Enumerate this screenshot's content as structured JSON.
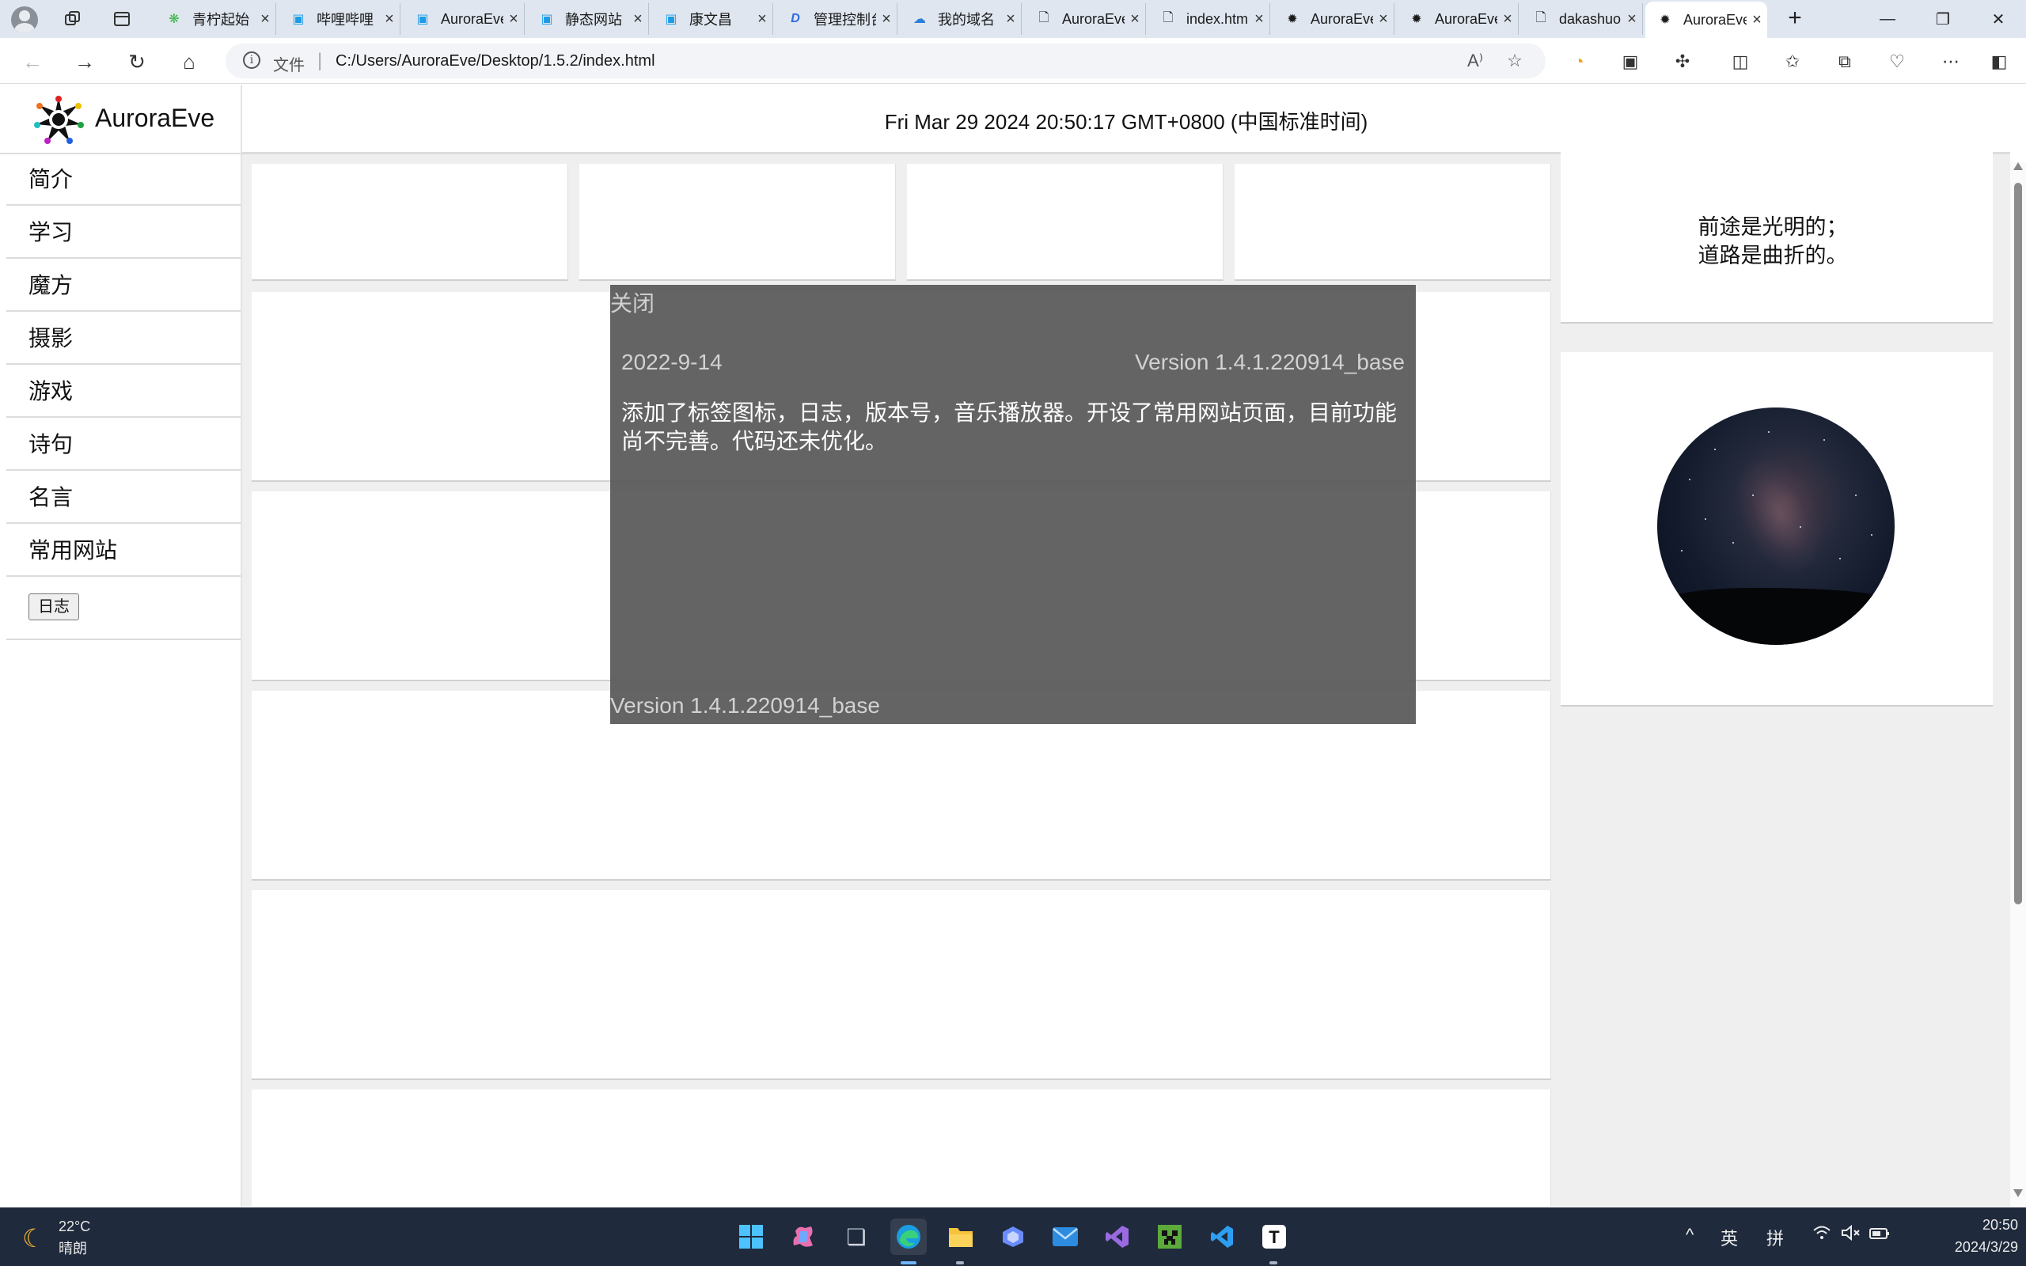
{
  "browser": {
    "tabs": [
      {
        "title": "青柠起始",
        "icon": "lime-icon",
        "color": "#3bb54a"
      },
      {
        "title": "哔哩哔哩",
        "icon": "bilibili-icon",
        "color": "#1e9be6"
      },
      {
        "title": "AuroraEve",
        "icon": "bilibili-icon",
        "color": "#1e9be6"
      },
      {
        "title": "静态网站",
        "icon": "bilibili-icon",
        "color": "#1e9be6"
      },
      {
        "title": "康文昌",
        "icon": "bilibili-icon",
        "color": "#1e9be6"
      },
      {
        "title": "管理控制台",
        "icon": "d-logo-icon",
        "color": "#2e6be6"
      },
      {
        "title": "我的域名",
        "icon": "cloud-icon",
        "color": "#2b7fd8"
      },
      {
        "title": "AuroraEve",
        "icon": "file-icon",
        "color": "#444444"
      },
      {
        "title": "index.html",
        "icon": "file-icon",
        "color": "#444444"
      },
      {
        "title": "AuroraEve",
        "icon": "aurora-logo-icon",
        "color": "#222222"
      },
      {
        "title": "AuroraEve",
        "icon": "aurora-logo-icon",
        "color": "#222222"
      },
      {
        "title": "dakashuo",
        "icon": "file-icon",
        "color": "#444444"
      },
      {
        "title": "AuroraEve",
        "icon": "aurora-logo-icon",
        "color": "#222222",
        "active": true
      }
    ],
    "address": {
      "scheme_label": "文件",
      "url": "C:/Users/AuroraEve/Desktop/1.5.2/index.html"
    }
  },
  "site": {
    "name": "AuroraEve",
    "datetime": "Fri Mar 29 2024 20:50:17 GMT+0800 (中国标准时间)",
    "nav": [
      "简介",
      "学习",
      "魔方",
      "摄影",
      "游戏",
      "诗句",
      "名言",
      "常用网站"
    ],
    "log_button": "日志",
    "quote": {
      "line1": "前途是光明的；",
      "line2": "道路是曲折的。"
    },
    "photo_icon": "night-sky-photo"
  },
  "modal": {
    "close_label": "关闭",
    "date": "2022-9-14",
    "version": "Version 1.4.1.220914_base",
    "body": "添加了标签图标，日志，版本号，音乐播放器。开设了常用网站页面，目前功能尚不完善。代码还未优化。",
    "footer_version": "Version 1.4.1.220914_base"
  },
  "taskbar": {
    "weather": {
      "temp": "22°C",
      "desc": "晴朗",
      "icon": "moon-icon"
    },
    "tray": {
      "ime_lang": "英",
      "ime_mode": "拼"
    },
    "clock": {
      "time": "20:50",
      "date": "2024/3/29"
    }
  },
  "colors": {
    "modal_bg": "#585858",
    "taskbar_bg": "#1f2a3c",
    "page_bg": "#efefef"
  }
}
